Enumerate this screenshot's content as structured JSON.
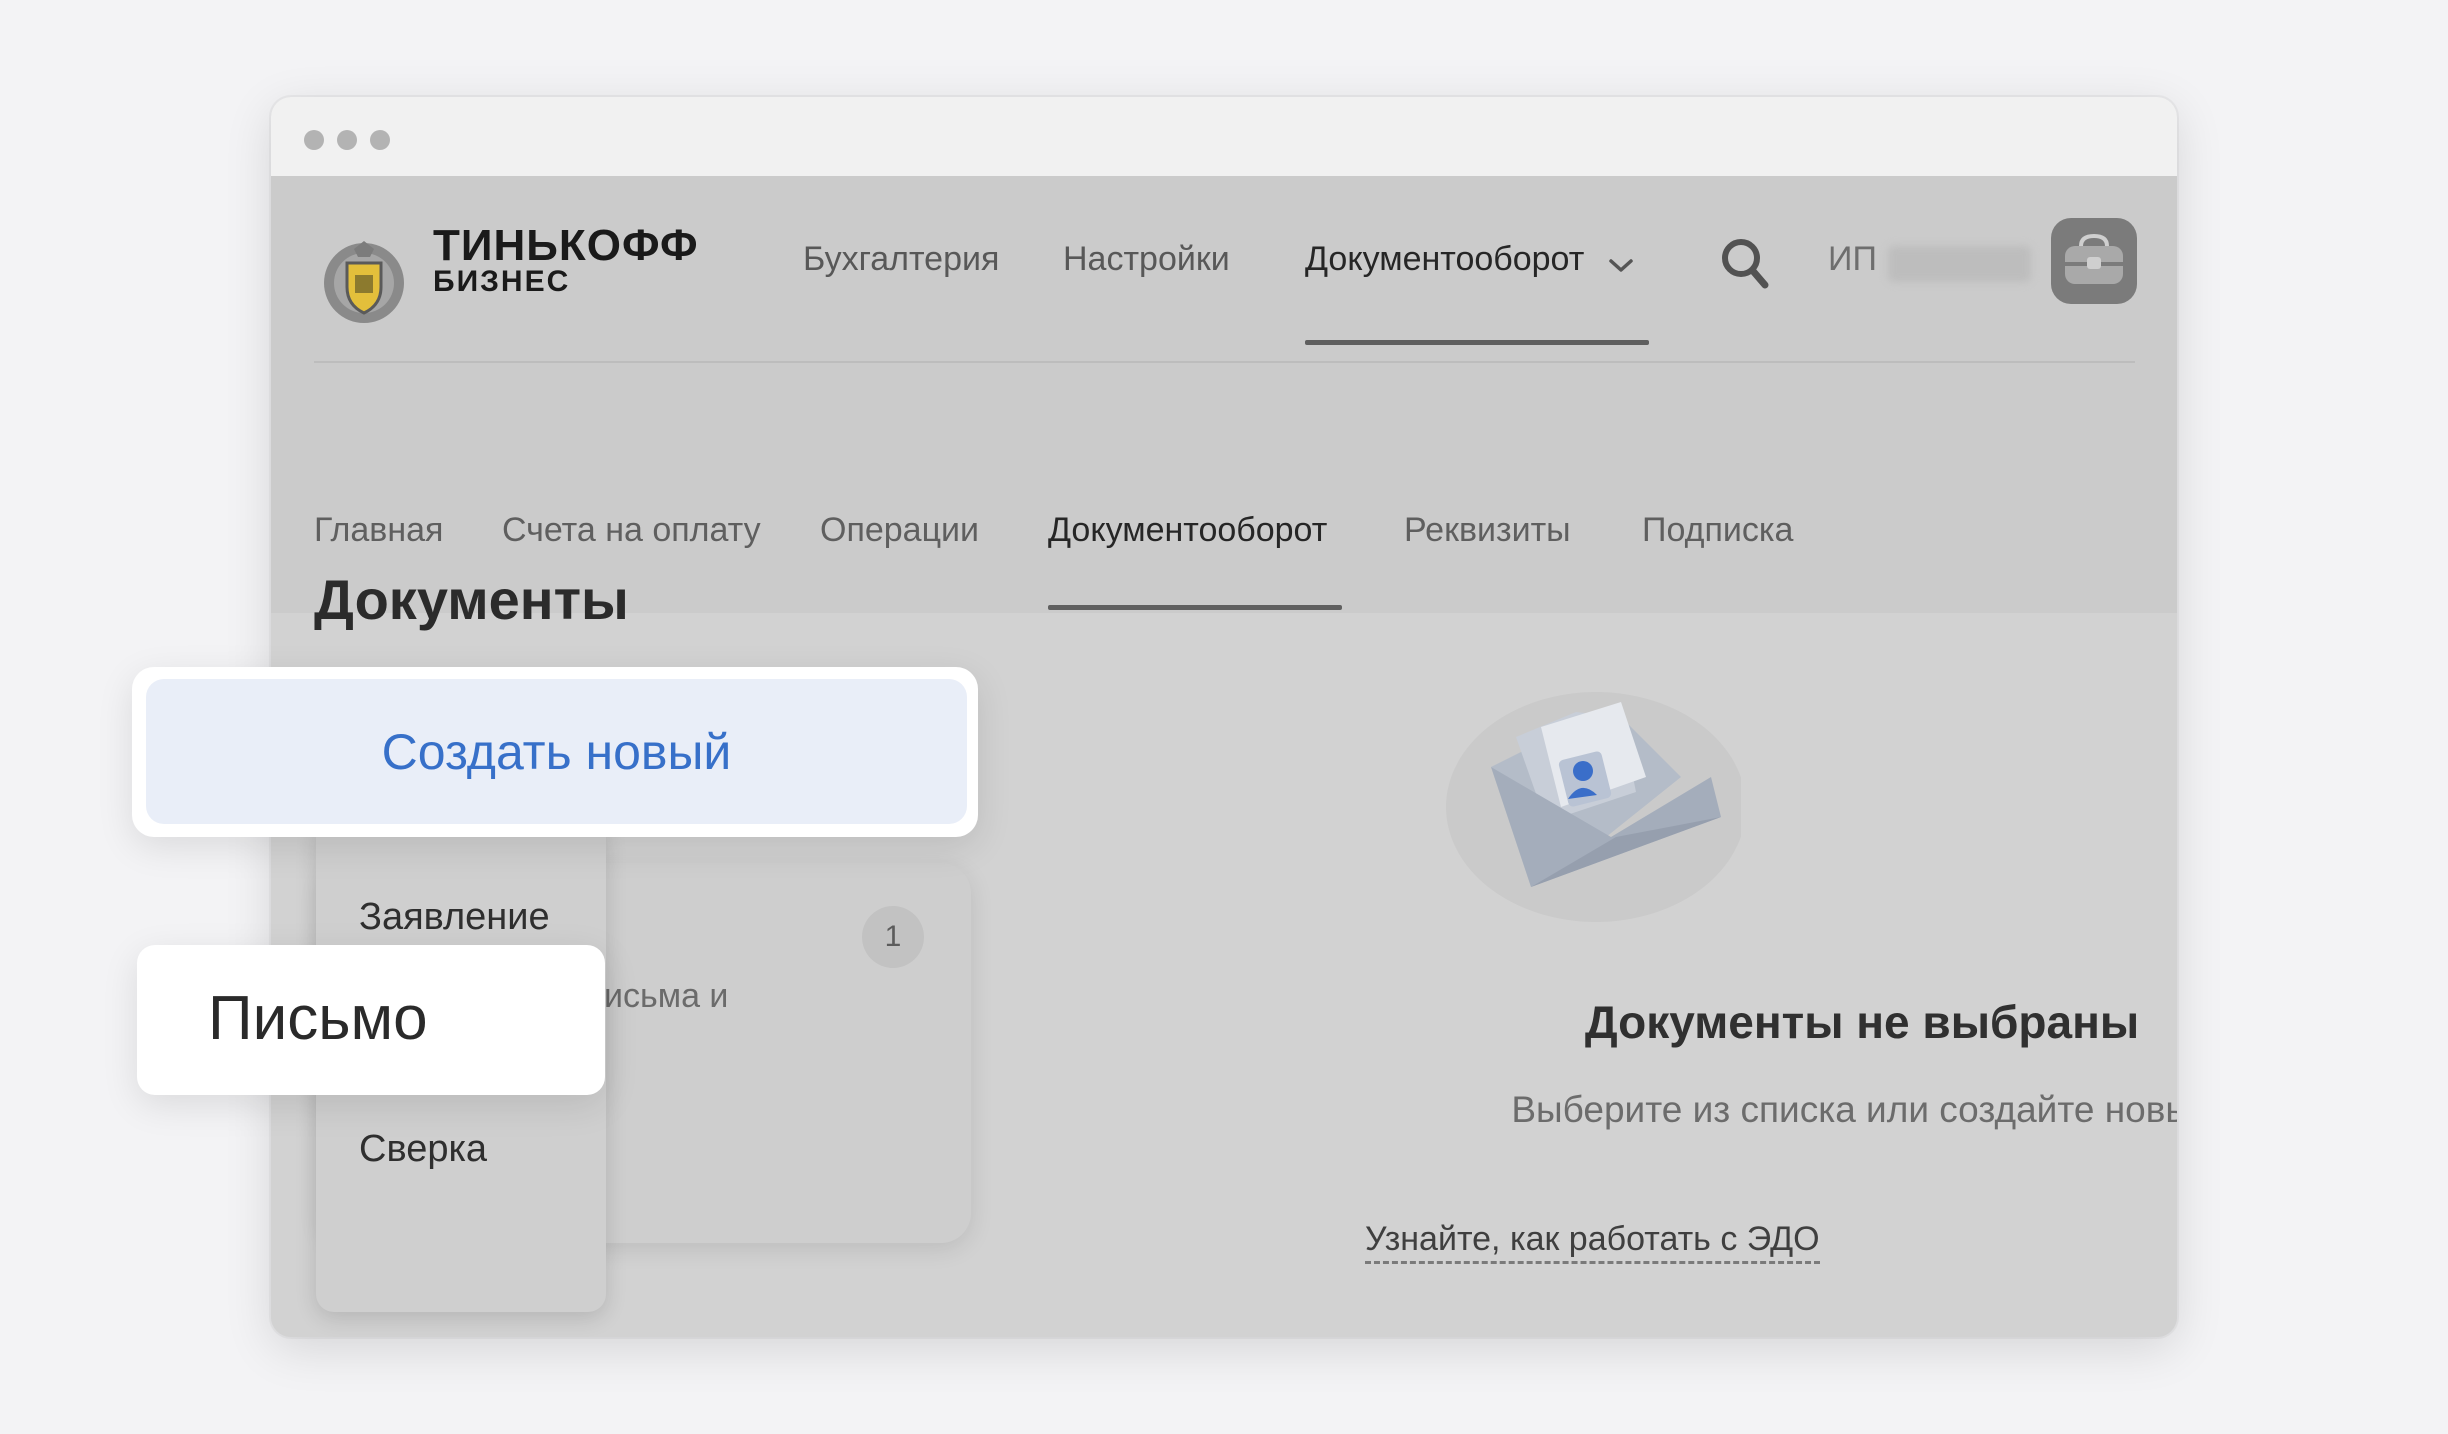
{
  "brand": {
    "line1": "ТИНЬКОФФ",
    "line2": "БИЗНЕС"
  },
  "top_nav": {
    "items": [
      {
        "label": "Бухгалтерия"
      },
      {
        "label": "Настройки"
      },
      {
        "label": "Документооборот",
        "active": true
      }
    ],
    "account_prefix": "ИП"
  },
  "sub_nav": {
    "items": [
      {
        "label": "Главная"
      },
      {
        "label": "Счета на оплату"
      },
      {
        "label": "Операции"
      },
      {
        "label": "Документооборот",
        "active": true
      },
      {
        "label": "Реквизиты"
      },
      {
        "label": "Подписка"
      }
    ]
  },
  "main": {
    "title": "Документы",
    "create_button": "Создать новый",
    "menu": {
      "items": [
        {
          "label": "Заявление"
        },
        {
          "label": "Письмо",
          "highlighted": true
        },
        {
          "label": "Сверка"
        }
      ]
    },
    "list_card": {
      "count": "1",
      "snippet": "исьма и"
    }
  },
  "empty_state": {
    "title": "Документы не выбраны",
    "subtitle": "Выберите из списка или создайте новый",
    "link": "Узнайте, как работать с ЭДО"
  },
  "icons": {
    "logo": "tinkoff-crest-logo",
    "search": "search-icon",
    "chevron": "chevron-down-icon",
    "avatar": "briefcase-icon",
    "illustration": "envelope-icon"
  },
  "colors": {
    "accent": "#3770c9",
    "create_bg": "#e9eef8",
    "overlay_gray": "#cbcbcb"
  }
}
